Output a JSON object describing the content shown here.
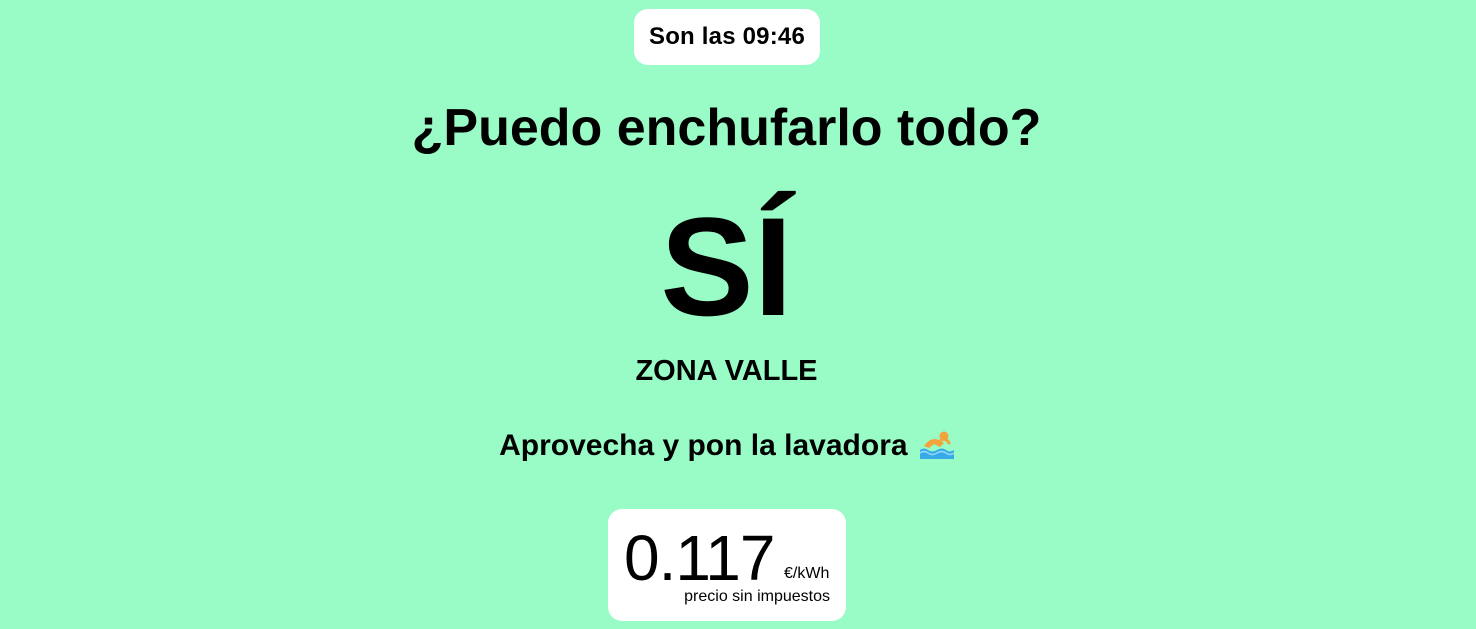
{
  "header": {
    "time_text": "Son las 09:46"
  },
  "main": {
    "question": "¿Puedo enchufarlo todo?",
    "answer": "SÍ",
    "zone": "ZONA VALLE",
    "advice": "Aprovecha y pon la lavadora",
    "advice_icon": "swimmer-icon"
  },
  "price": {
    "value": "0.117",
    "unit": "€/kWh",
    "note": "precio sin impuestos"
  },
  "colors": {
    "background": "#99fcc6",
    "card": "#ffffff",
    "text": "#000000"
  }
}
